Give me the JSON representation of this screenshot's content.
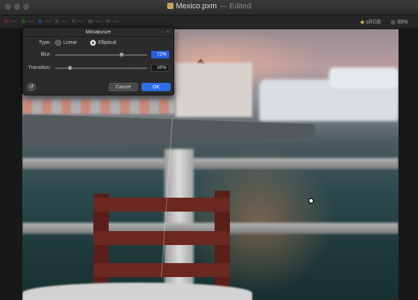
{
  "window": {
    "title": "Mexico.pxm",
    "edited": "— Edited"
  },
  "infobar": {
    "stats": [
      {
        "key": "R:",
        "value": "----"
      },
      {
        "key": "G:",
        "value": "----"
      },
      {
        "key": "B:",
        "value": "----"
      },
      {
        "key": "X:",
        "value": "----"
      },
      {
        "key": "Y:",
        "value": "----"
      },
      {
        "key": "W:",
        "value": "----"
      },
      {
        "key": "H:",
        "value": "----"
      }
    ],
    "color_profile": "sRGB",
    "zoom": "98%"
  },
  "panel": {
    "title": "Miniaturize",
    "type_label": "Type:",
    "type_options": [
      "Linear",
      "Elliptical"
    ],
    "type_selected": "Elliptical",
    "blur_label": "Blur:",
    "blur_value": "72%",
    "blur_level": 0.72,
    "transition_label": "Transition:",
    "transition_value": "16%",
    "transition_level": 0.16,
    "cancel_label": "Cancel",
    "ok_label": "OK"
  }
}
